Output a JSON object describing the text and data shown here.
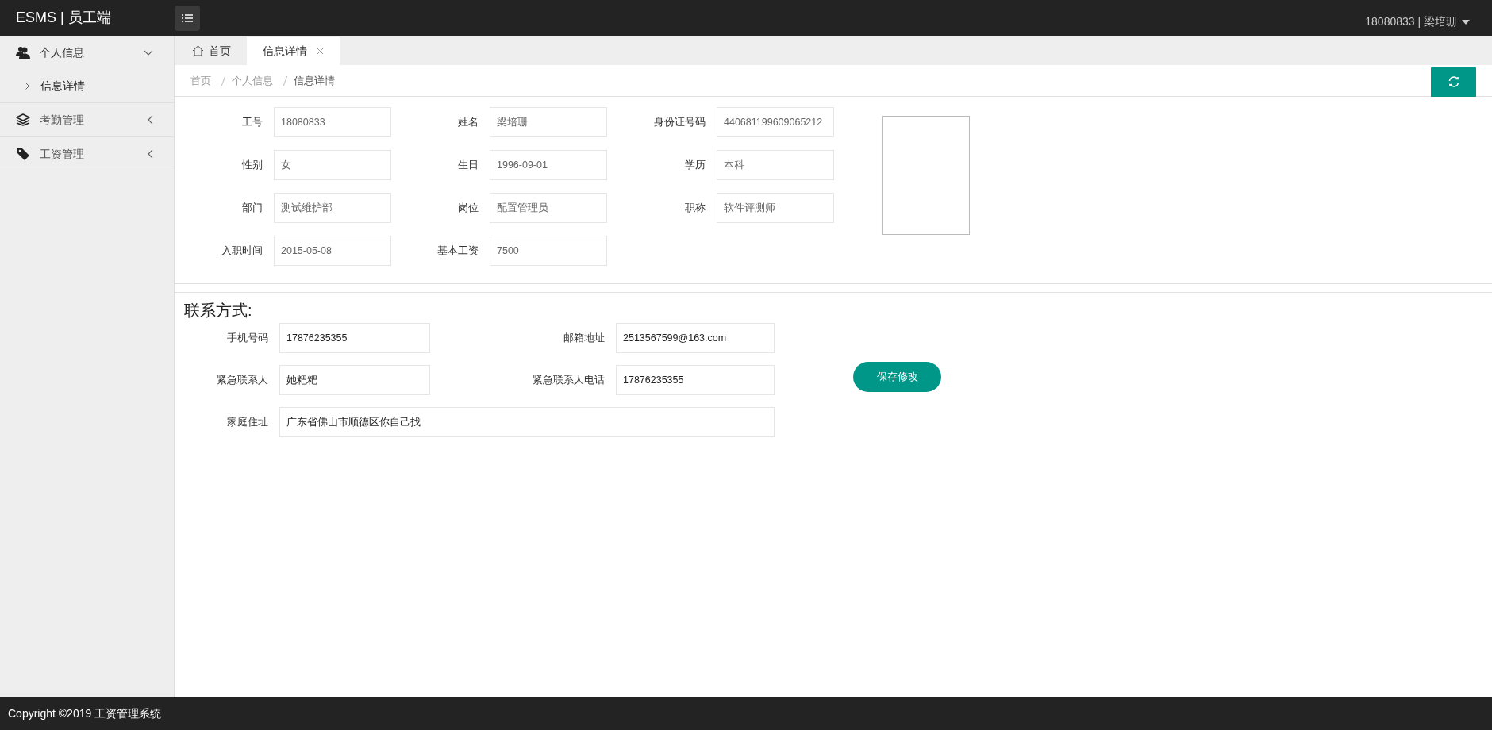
{
  "header": {
    "brand": "ESMS | 员工端",
    "user": "18080833 | 梁培珊"
  },
  "sidebar": {
    "items": [
      {
        "label": "个人信息",
        "expanded": true,
        "children": [
          {
            "label": "信息详情",
            "selected": true
          }
        ]
      },
      {
        "label": "考勤管理",
        "expanded": false
      },
      {
        "label": "工资管理",
        "expanded": false
      }
    ]
  },
  "tabs": [
    {
      "label": "首页",
      "kind": "home",
      "selected": false
    },
    {
      "label": "信息详情",
      "kind": "closable",
      "selected": true
    }
  ],
  "breadcrumb": [
    "首页",
    "个人信息",
    "信息详情"
  ],
  "profile_fields": [
    {
      "label": "工号",
      "value": "18080833",
      "disabled": true
    },
    {
      "label": "姓名",
      "value": "梁培珊",
      "disabled": true
    },
    {
      "label": "身份证号码",
      "value": "440681199609065212",
      "disabled": true
    },
    {
      "label": "性别",
      "value": "女",
      "disabled": true
    },
    {
      "label": "生日",
      "value": "1996-09-01",
      "disabled": true
    },
    {
      "label": "学历",
      "value": "本科",
      "disabled": true
    },
    {
      "label": "部门",
      "value": "测试维护部",
      "disabled": true
    },
    {
      "label": "岗位",
      "value": "配置管理员",
      "disabled": true
    },
    {
      "label": "职称",
      "value": "软件评测师",
      "disabled": true
    },
    {
      "label": "入职时间",
      "value": "2015-05-08",
      "disabled": true
    },
    {
      "label": "基本工资",
      "value": "7500",
      "disabled": true
    }
  ],
  "contact": {
    "title": "联系方式:",
    "fields": [
      {
        "label": "手机号码",
        "value": "17876235355",
        "disabled": false
      },
      {
        "label": "邮箱地址",
        "value": "2513567599@163.com",
        "disabled": false
      },
      {
        "label": "紧急联系人",
        "value": "她粑粑",
        "disabled": false
      },
      {
        "label": "紧急联系人电话",
        "value": "17876235355",
        "disabled": false
      },
      {
        "label": "家庭住址",
        "value": "广东省佛山市顺德区你自己找",
        "disabled": false
      }
    ],
    "save_button": "保存修改"
  },
  "footer": "Copyright ©2019 工资管理系统"
}
